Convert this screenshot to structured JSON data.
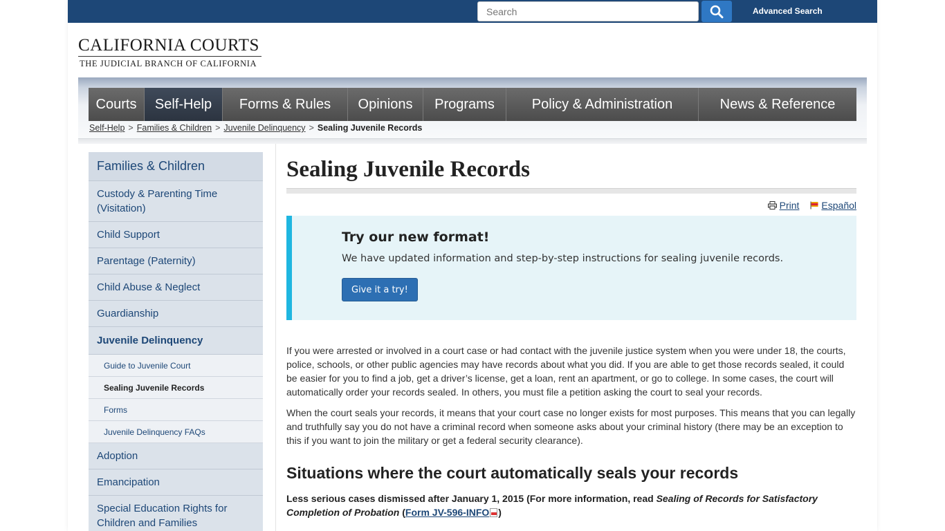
{
  "header": {
    "search_placeholder": "Search",
    "advanced_search": "Advanced Search"
  },
  "logo": {
    "title": "CALIFORNIA COURTS",
    "subtitle": "THE JUDICIAL BRANCH OF CALIFORNIA"
  },
  "nav": [
    {
      "label": "Courts"
    },
    {
      "label": "Self-Help",
      "active": true
    },
    {
      "label": "Forms & Rules"
    },
    {
      "label": "Opinions"
    },
    {
      "label": "Programs"
    },
    {
      "label": "Policy & Administration"
    },
    {
      "label": "News & Reference"
    }
  ],
  "breadcrumb": {
    "items": [
      "Self-Help",
      "Families & Children",
      "Juvenile Delinquency"
    ],
    "current": "Sealing Juvenile Records",
    "separator": ">"
  },
  "sidebar": {
    "heading": "Families & Children",
    "items": [
      "Custody & Parenting Time (Visitation)",
      "Child Support",
      "Parentage (Paternity)",
      "Child Abuse & Neglect",
      "Guardianship",
      "Juvenile Delinquency"
    ],
    "sub_items": [
      "Guide to Juvenile Court",
      "Sealing Juvenile Records",
      "Forms",
      "Juvenile Delinquency FAQs"
    ],
    "items_after": [
      "Adoption",
      "Emancipation",
      "Special Education Rights for Children and Families"
    ]
  },
  "main": {
    "title": "Sealing Juvenile Records",
    "print": "Print",
    "espanol": "Español",
    "callout": {
      "heading": "Try our new format!",
      "text": "We have updated information and step-by-step instructions for sealing juvenile records.",
      "button": "Give it a try!"
    },
    "para1": "If you were arrested or involved in a court case or had contact with the juvenile justice system when you were under 18, the courts, police, schools, or other public agencies may have records about what you did. If you are able to get those records sealed, it could be easier for you to find a job, get a driver’s license, get a loan, rent an apartment, or go to college. In some cases, the court will automatically order your records sealed. In others, you must file a petition asking the court to seal your records.",
    "para2": "When the court seals your records, it means that your court case no longer exists for most purposes. This means that you can legally and truthfully say you do not have a criminal record when someone asks about your criminal history (there may be an exception to this if you want to join the military or get a federal security clearance).",
    "section_heading": "Situations where the court automatically seals your records",
    "sub_lead": "Less serious cases dismissed after January 1, 2015 (For more information, read ",
    "sub_italic": "Sealing of Records for Satisfactory Completion of Probation",
    "sub_open": " (",
    "sub_link": "Form JV-596-INFO",
    "sub_close": ")"
  },
  "colors": {
    "topbar": "#1d4777",
    "search_button": "#2f78c4",
    "callout_bg": "#e6f4f8",
    "callout_accent": "#1fb6e0",
    "sidebar_bg": "#dbe2ea",
    "link": "#1d4777"
  },
  "icons": {
    "search": "search-icon",
    "print": "printer-icon",
    "espanol": "flag-icon",
    "pdf": "pdf-icon"
  }
}
